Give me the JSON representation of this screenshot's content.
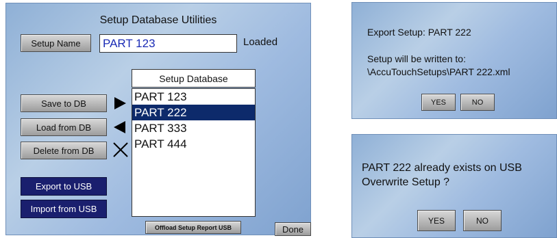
{
  "main": {
    "title": "Setup Database Utilities",
    "setup_name_label": "Setup Name",
    "setup_name_value": "PART 123",
    "status": "Loaded",
    "db_header": "Setup Database",
    "db_items": [
      "PART 123",
      "PART 222",
      "PART 333",
      "PART 444"
    ],
    "selected_index": 1,
    "save_label": "Save to DB",
    "load_label": "Load from DB",
    "delete_label": "Delete from DB",
    "export_label": "Export to USB",
    "import_label": "Import from USB",
    "offload_label": "Offload Setup Report USB",
    "done_label": "Done"
  },
  "export_dialog": {
    "line1": "Export Setup: PART 222",
    "line2": "Setup will be written to:",
    "line3": "\\AccuTouchSetups\\PART 222.xml",
    "yes_label": "YES",
    "no_label": "NO"
  },
  "overwrite_dialog": {
    "line1": "PART 222 already exists on USB",
    "line2": "Overwrite Setup ?",
    "yes_label": "YES",
    "no_label": "NO"
  },
  "icons": {
    "save_arrow": "arrow-right-icon",
    "load_arrow": "arrow-left-icon",
    "delete_mark": "x-icon"
  }
}
